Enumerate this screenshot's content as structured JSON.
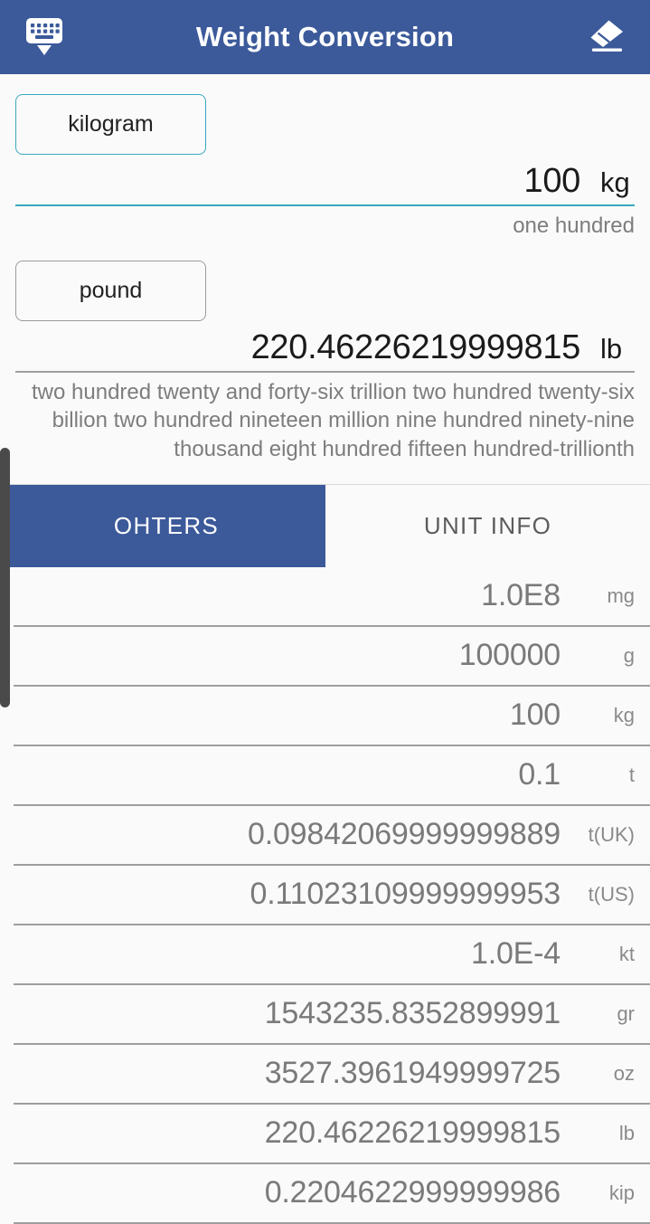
{
  "appbar": {
    "title": "Weight Conversion",
    "left_icon": "keyboard-hide-icon",
    "right_icon": "eraser-icon",
    "background": "#3c5a9a"
  },
  "converter": {
    "source": {
      "unit_button_label": "kilogram",
      "value": "100",
      "unit_symbol": "kg",
      "spelled_out": "one hundred",
      "accent_color": "#39a9c0"
    },
    "target": {
      "unit_button_label": "pound",
      "value": "220.46226219999815",
      "unit_symbol": "lb",
      "spelled_out": "two hundred twenty and forty-six trillion two hundred twenty-six billion two hundred nineteen million nine hundred ninety-nine thousand eight hundred fifteen hundred-trillionth",
      "accent_color": "#9e9e9e"
    }
  },
  "tabs": [
    {
      "label": "OHTERS",
      "active": true
    },
    {
      "label": "UNIT INFO",
      "active": false
    }
  ],
  "unit_list": [
    {
      "value": "1.0E8",
      "unit": "mg"
    },
    {
      "value": "100000",
      "unit": "g"
    },
    {
      "value": "100",
      "unit": "kg"
    },
    {
      "value": "0.1",
      "unit": "t"
    },
    {
      "value": "0.09842069999999889",
      "unit": "t(UK)"
    },
    {
      "value": "0.11023109999999953",
      "unit": "t(US)"
    },
    {
      "value": "1.0E-4",
      "unit": "kt"
    },
    {
      "value": "1543235.8352899991",
      "unit": "gr"
    },
    {
      "value": "3527.3961949999725",
      "unit": "oz"
    },
    {
      "value": "220.46226219999815",
      "unit": "lb"
    },
    {
      "value": "0.2204622999999986",
      "unit": "kip"
    }
  ],
  "scroll_handle": {
    "name": "scroll-drag-handle"
  }
}
